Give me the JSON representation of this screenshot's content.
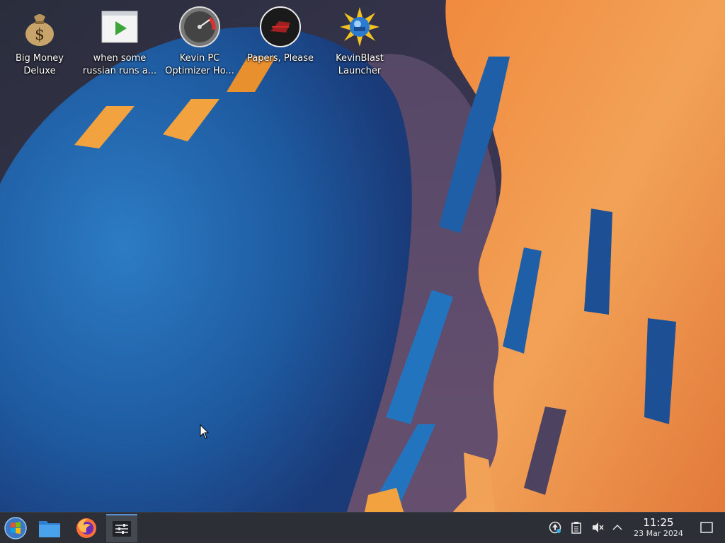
{
  "desktop": {
    "icons": [
      {
        "name": "big-money-deluxe",
        "line1": "Big Money",
        "line2": "Deluxe"
      },
      {
        "name": "video-file",
        "line1": "when some",
        "line2": "russian runs a..."
      },
      {
        "name": "kevin-pc-optimizer",
        "line1": "Kevin PC",
        "line2": "Optimizer Ho..."
      },
      {
        "name": "papers-please",
        "line1": "Papers, Please",
        "line2": ""
      },
      {
        "name": "kevinblast-launcher",
        "line1": "KevinBlast",
        "line2": "Launcher"
      }
    ]
  },
  "taskbar": {
    "launchers": [
      {
        "icon": "start-menu-icon"
      },
      {
        "icon": "file-manager-icon"
      },
      {
        "icon": "firefox-icon"
      },
      {
        "icon": "system-settings-icon",
        "active": true
      }
    ],
    "tray": [
      {
        "icon": "update-notifier-icon"
      },
      {
        "icon": "clipboard-icon"
      },
      {
        "icon": "volume-muted-icon"
      },
      {
        "icon": "chevron-up-icon"
      }
    ],
    "clock": {
      "time": "11:25",
      "date": "23 Mar 2024"
    },
    "show_desktop_icon": "show-desktop-icon"
  },
  "colors": {
    "taskbar_bg": "#2c2f36",
    "wallpaper_blue": "#1f6fb4",
    "wallpaper_orange": "#f08a3e",
    "accent": "#5b8fd6"
  }
}
